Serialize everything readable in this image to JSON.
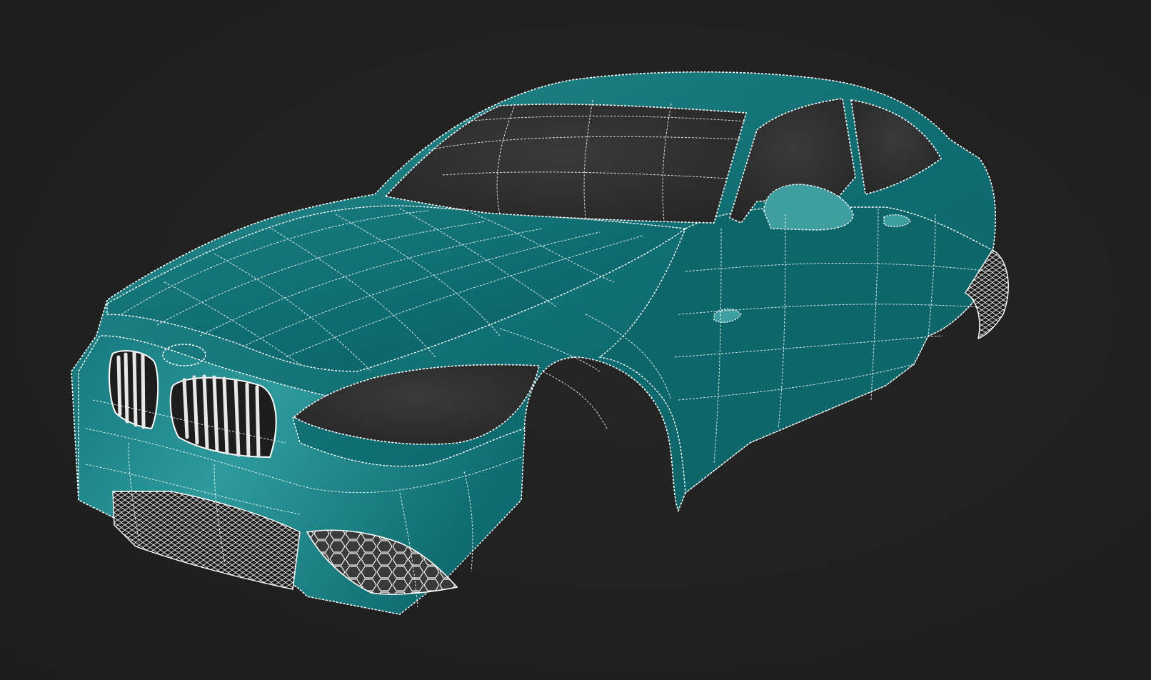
{
  "viewport": {
    "background_color": "#202020"
  },
  "model": {
    "body_color": "#0f6e72",
    "body_highlight_color": "#5fb9b9",
    "wire_color": "#ffffff",
    "glass_color": "#2a2a2a",
    "grille_color": "#dcdcdc",
    "display_mode": "wireframe-on-shaded"
  }
}
